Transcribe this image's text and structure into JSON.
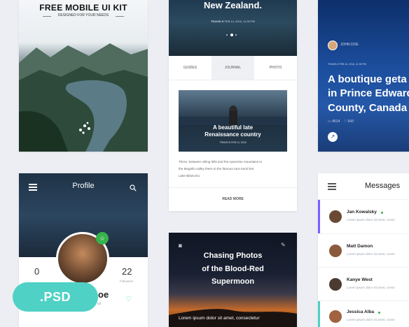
{
  "kit": {
    "title": "FREE MOBILE UI KIT",
    "subtitle": "DESIGNED FOR YOUR NEEDS"
  },
  "nz": {
    "title": "New Zealand.",
    "meta_label": "TRAVELS",
    "meta_date": "FEB 14, 2016, 11:35 PM",
    "tabs": [
      "GUIDES",
      "JOURNAL",
      "PHOTO"
    ],
    "feature_title_1": "A beautiful late",
    "feature_title_2": "Renaissance country",
    "feature_meta": "TRAVELS FEB 14, 2016",
    "body_1": "There, between rolling hills and the Apennine mountains in",
    "body_2": "the Mugello valley there to the famous race track lies",
    "body_3": "Lake Bilancino.",
    "read_more": "READ MORE"
  },
  "boutique": {
    "author": "JOHN DOE",
    "meta": "TRAVELS FEB 14, 2016, 11:35 PM",
    "title_1": "A boutique geta",
    "title_2": "in Prince Edward",
    "title_3": "County, Canada",
    "stat_comments": "4514",
    "stat_likes": "543"
  },
  "profile": {
    "title": "Profile",
    "stat_left": "0",
    "stat_right": "22",
    "stat_right_label": "Followers",
    "name_fragment": "oe",
    "sub_fragment": "ial"
  },
  "psd_badge": ".PSD",
  "photos": {
    "title_1": "Chasing Photos",
    "title_2": "of the Blood-Red",
    "title_3": "Supermoon",
    "caption": "Lorem ipsum dolor sit amet, consectetur"
  },
  "messages": {
    "title": "Messages",
    "items": [
      {
        "name": "Jan Kowalsky",
        "preview": "Lorem ipsum dolor sit amet, conse"
      },
      {
        "name": "Matt Damon",
        "preview": "Lorem ipsum dolor sit amet, conse"
      },
      {
        "name": "Kanye West",
        "preview": "Lorem ipsum dolor sit amet, conse"
      },
      {
        "name": "Jessica Alba",
        "preview": "Lorem ipsum dolor sit amet, conse"
      }
    ]
  },
  "colors": {
    "accent_teal": "#4fd1c5",
    "accent_green": "#37b24d",
    "accent_purple": "#7b61ff",
    "dark_navy": "#1c2536",
    "blue_card": "#1e4a8a"
  }
}
